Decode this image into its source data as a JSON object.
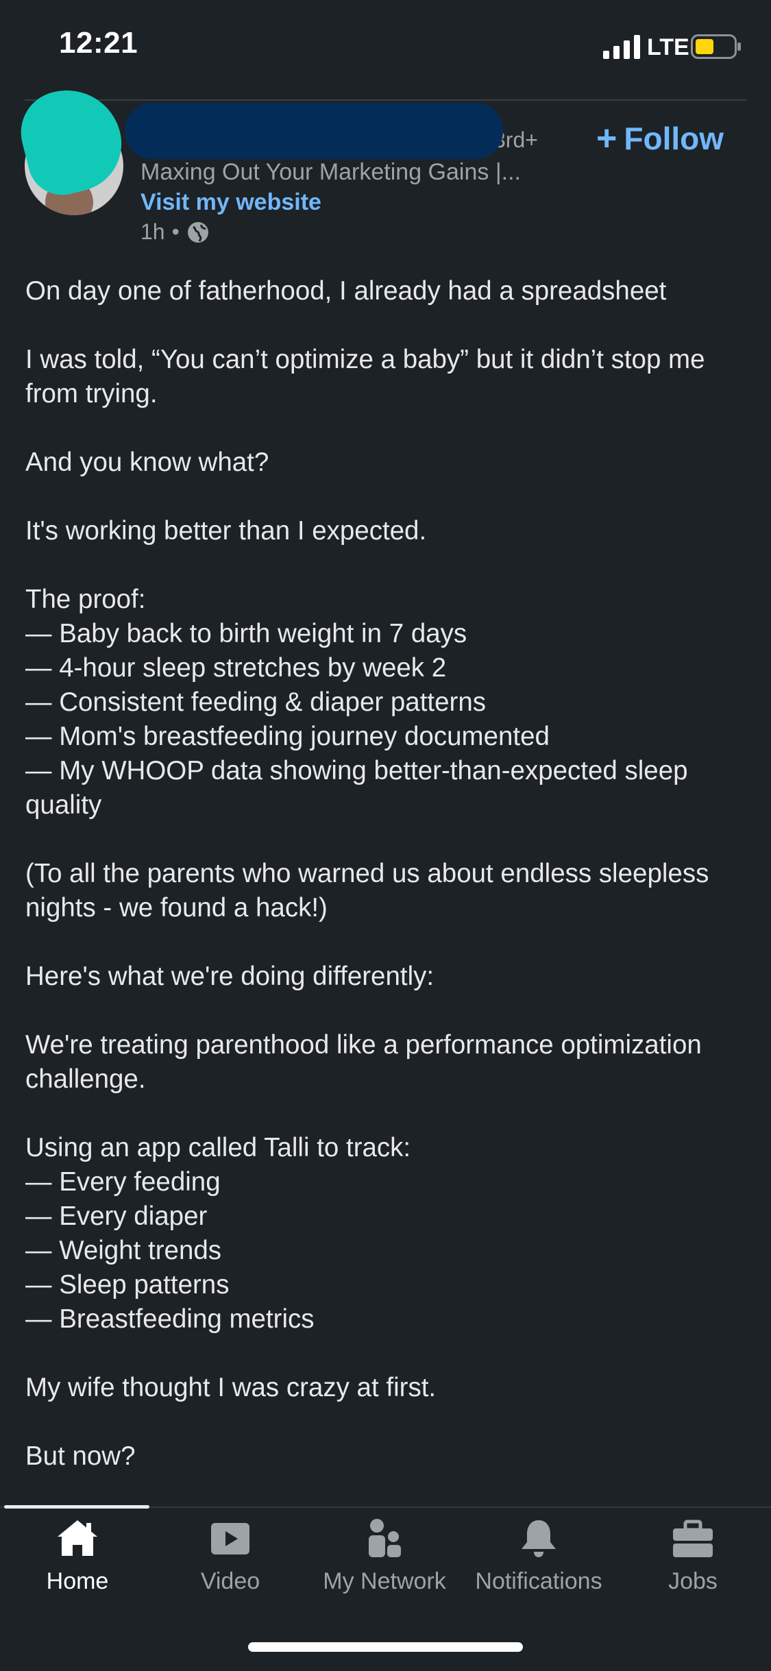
{
  "status_bar": {
    "time": "12:21",
    "network": "LTE",
    "battery_color": "#ffd60a"
  },
  "post": {
    "connection_degree": "3rd+",
    "follow_label": "Follow",
    "headline": "Maxing Out Your Marketing Gains |...",
    "website_link": "Visit my website",
    "time_ago": "1h",
    "meta_separator": "•",
    "visibility_icon": "globe-icon",
    "paragraphs": [
      "On day one of fatherhood, I already had a spreadsheet",
      "I was told, “You can’t optimize a baby” but it didn’t stop me from trying.",
      "And you know what?",
      "It's working better than I expected."
    ],
    "proof_heading": "The proof:",
    "proof_items": [
      "— Baby back to birth weight in 7 days",
      "— 4-hour sleep stretches by week 2",
      "— Consistent feeding & diaper patterns",
      "— Mom's breastfeeding journey documented",
      "— My WHOOP data showing better-than-expected sleep quality"
    ],
    "paragraphs_2": [
      "(To all the parents who warned us about endless sleepless nights - we found a hack!)",
      "Here's what we're doing differently:",
      "We're treating parenthood like a performance optimization challenge."
    ],
    "track_heading": "Using an app called Talli to track:",
    "track_items": [
      "— Every feeding",
      "— Every diaper",
      "— Weight trends",
      "— Sleep patterns",
      "— Breastfeeding metrics"
    ],
    "paragraphs_3": [
      "My wife thought I was crazy at first.",
      "But now?"
    ]
  },
  "nav": {
    "items": [
      {
        "label": "Home",
        "icon": "home-icon",
        "active": true
      },
      {
        "label": "Video",
        "icon": "video-icon",
        "active": false
      },
      {
        "label": "My Network",
        "icon": "network-icon",
        "active": false
      },
      {
        "label": "Notifications",
        "icon": "bell-icon",
        "active": false
      },
      {
        "label": "Jobs",
        "icon": "briefcase-icon",
        "active": false
      }
    ]
  },
  "colors": {
    "background": "#1d2226",
    "link": "#71b7fb",
    "avatar_redaction": "#12c9b8",
    "name_redaction": "#032d58"
  }
}
